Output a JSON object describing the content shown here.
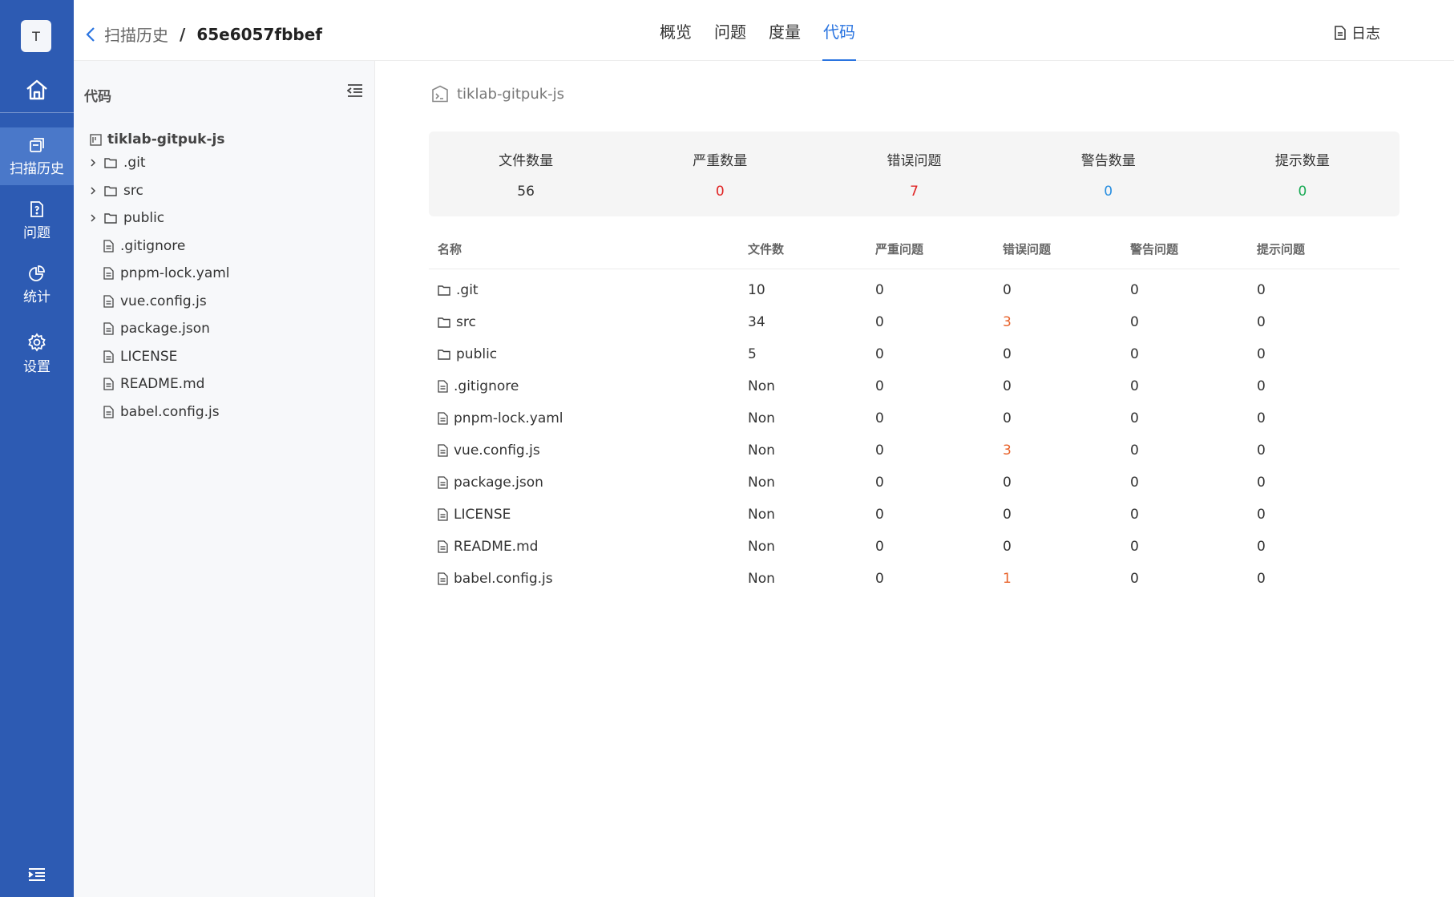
{
  "nav": {
    "avatar": "T",
    "items": [
      {
        "label": "扫描历史",
        "icon": "history-icon",
        "active": true
      },
      {
        "label": "问题",
        "icon": "issue-icon",
        "active": false
      },
      {
        "label": "统计",
        "icon": "pie-chart-icon",
        "active": false
      },
      {
        "label": "设置",
        "icon": "gear-icon",
        "active": false
      }
    ]
  },
  "header": {
    "breadcrumb_parent": "扫描历史",
    "breadcrumb_separator": "/",
    "breadcrumb_current": "65e6057fbbef",
    "tabs": [
      "概览",
      "问题",
      "度量",
      "代码"
    ],
    "active_tab": "代码",
    "log_label": "日志"
  },
  "tree": {
    "title": "代码",
    "root": "tiklab-gitpuk-js",
    "nodes": [
      {
        "name": ".git",
        "type": "folder"
      },
      {
        "name": "src",
        "type": "folder"
      },
      {
        "name": "public",
        "type": "folder"
      },
      {
        "name": ".gitignore",
        "type": "file"
      },
      {
        "name": "pnpm-lock.yaml",
        "type": "file"
      },
      {
        "name": "vue.config.js",
        "type": "file"
      },
      {
        "name": "package.json",
        "type": "file"
      },
      {
        "name": "LICENSE",
        "type": "file"
      },
      {
        "name": "README.md",
        "type": "file"
      },
      {
        "name": "babel.config.js",
        "type": "file"
      }
    ]
  },
  "main": {
    "repo_title": "tiklab-gitpuk-js",
    "summary": [
      {
        "label": "文件数量",
        "value": "56",
        "color": "#333333"
      },
      {
        "label": "严重数量",
        "value": "0",
        "color": "#e02424"
      },
      {
        "label": "错误问题",
        "value": "7",
        "color": "#e02424"
      },
      {
        "label": "警告数量",
        "value": "0",
        "color": "#2a8fe0"
      },
      {
        "label": "提示数量",
        "value": "0",
        "color": "#1aaa55"
      }
    ],
    "columns": [
      "名称",
      "文件数",
      "严重问题",
      "错误问题",
      "警告问题",
      "提示问题"
    ],
    "rows": [
      {
        "name": ".git",
        "type": "folder",
        "files": "10",
        "critical": "0",
        "error": "0",
        "warning": "0",
        "hint": "0"
      },
      {
        "name": "src",
        "type": "folder",
        "files": "34",
        "critical": "0",
        "error": "3",
        "warning": "0",
        "hint": "0"
      },
      {
        "name": "public",
        "type": "folder",
        "files": "5",
        "critical": "0",
        "error": "0",
        "warning": "0",
        "hint": "0"
      },
      {
        "name": ".gitignore",
        "type": "file",
        "files": "Non",
        "critical": "0",
        "error": "0",
        "warning": "0",
        "hint": "0"
      },
      {
        "name": "pnpm-lock.yaml",
        "type": "file",
        "files": "Non",
        "critical": "0",
        "error": "0",
        "warning": "0",
        "hint": "0"
      },
      {
        "name": "vue.config.js",
        "type": "file",
        "files": "Non",
        "critical": "0",
        "error": "3",
        "warning": "0",
        "hint": "0"
      },
      {
        "name": "package.json",
        "type": "file",
        "files": "Non",
        "critical": "0",
        "error": "0",
        "warning": "0",
        "hint": "0"
      },
      {
        "name": "LICENSE",
        "type": "file",
        "files": "Non",
        "critical": "0",
        "error": "0",
        "warning": "0",
        "hint": "0"
      },
      {
        "name": "README.md",
        "type": "file",
        "files": "Non",
        "critical": "0",
        "error": "0",
        "warning": "0",
        "hint": "0"
      },
      {
        "name": "babel.config.js",
        "type": "file",
        "files": "Non",
        "critical": "0",
        "error": "1",
        "warning": "0",
        "hint": "0"
      }
    ]
  }
}
